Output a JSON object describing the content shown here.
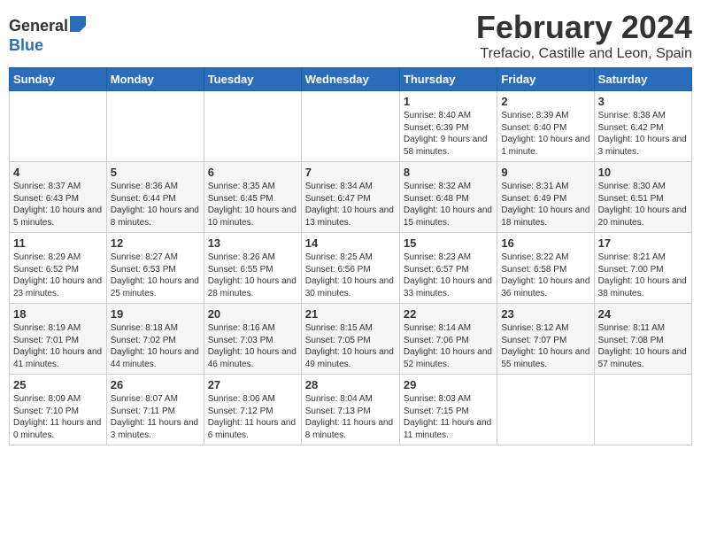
{
  "header": {
    "logo_general": "General",
    "logo_blue": "Blue",
    "title": "February 2024",
    "subtitle": "Trefacio, Castille and Leon, Spain"
  },
  "calendar": {
    "days_of_week": [
      "Sunday",
      "Monday",
      "Tuesday",
      "Wednesday",
      "Thursday",
      "Friday",
      "Saturday"
    ],
    "weeks": [
      [
        {
          "day": "",
          "info": ""
        },
        {
          "day": "",
          "info": ""
        },
        {
          "day": "",
          "info": ""
        },
        {
          "day": "",
          "info": ""
        },
        {
          "day": "1",
          "info": "Sunrise: 8:40 AM\nSunset: 6:39 PM\nDaylight: 9 hours and 58 minutes."
        },
        {
          "day": "2",
          "info": "Sunrise: 8:39 AM\nSunset: 6:40 PM\nDaylight: 10 hours and 1 minute."
        },
        {
          "day": "3",
          "info": "Sunrise: 8:38 AM\nSunset: 6:42 PM\nDaylight: 10 hours and 3 minutes."
        }
      ],
      [
        {
          "day": "4",
          "info": "Sunrise: 8:37 AM\nSunset: 6:43 PM\nDaylight: 10 hours and 5 minutes."
        },
        {
          "day": "5",
          "info": "Sunrise: 8:36 AM\nSunset: 6:44 PM\nDaylight: 10 hours and 8 minutes."
        },
        {
          "day": "6",
          "info": "Sunrise: 8:35 AM\nSunset: 6:45 PM\nDaylight: 10 hours and 10 minutes."
        },
        {
          "day": "7",
          "info": "Sunrise: 8:34 AM\nSunset: 6:47 PM\nDaylight: 10 hours and 13 minutes."
        },
        {
          "day": "8",
          "info": "Sunrise: 8:32 AM\nSunset: 6:48 PM\nDaylight: 10 hours and 15 minutes."
        },
        {
          "day": "9",
          "info": "Sunrise: 8:31 AM\nSunset: 6:49 PM\nDaylight: 10 hours and 18 minutes."
        },
        {
          "day": "10",
          "info": "Sunrise: 8:30 AM\nSunset: 6:51 PM\nDaylight: 10 hours and 20 minutes."
        }
      ],
      [
        {
          "day": "11",
          "info": "Sunrise: 8:29 AM\nSunset: 6:52 PM\nDaylight: 10 hours and 23 minutes."
        },
        {
          "day": "12",
          "info": "Sunrise: 8:27 AM\nSunset: 6:53 PM\nDaylight: 10 hours and 25 minutes."
        },
        {
          "day": "13",
          "info": "Sunrise: 8:26 AM\nSunset: 6:55 PM\nDaylight: 10 hours and 28 minutes."
        },
        {
          "day": "14",
          "info": "Sunrise: 8:25 AM\nSunset: 6:56 PM\nDaylight: 10 hours and 30 minutes."
        },
        {
          "day": "15",
          "info": "Sunrise: 8:23 AM\nSunset: 6:57 PM\nDaylight: 10 hours and 33 minutes."
        },
        {
          "day": "16",
          "info": "Sunrise: 8:22 AM\nSunset: 6:58 PM\nDaylight: 10 hours and 36 minutes."
        },
        {
          "day": "17",
          "info": "Sunrise: 8:21 AM\nSunset: 7:00 PM\nDaylight: 10 hours and 38 minutes."
        }
      ],
      [
        {
          "day": "18",
          "info": "Sunrise: 8:19 AM\nSunset: 7:01 PM\nDaylight: 10 hours and 41 minutes."
        },
        {
          "day": "19",
          "info": "Sunrise: 8:18 AM\nSunset: 7:02 PM\nDaylight: 10 hours and 44 minutes."
        },
        {
          "day": "20",
          "info": "Sunrise: 8:16 AM\nSunset: 7:03 PM\nDaylight: 10 hours and 46 minutes."
        },
        {
          "day": "21",
          "info": "Sunrise: 8:15 AM\nSunset: 7:05 PM\nDaylight: 10 hours and 49 minutes."
        },
        {
          "day": "22",
          "info": "Sunrise: 8:14 AM\nSunset: 7:06 PM\nDaylight: 10 hours and 52 minutes."
        },
        {
          "day": "23",
          "info": "Sunrise: 8:12 AM\nSunset: 7:07 PM\nDaylight: 10 hours and 55 minutes."
        },
        {
          "day": "24",
          "info": "Sunrise: 8:11 AM\nSunset: 7:08 PM\nDaylight: 10 hours and 57 minutes."
        }
      ],
      [
        {
          "day": "25",
          "info": "Sunrise: 8:09 AM\nSunset: 7:10 PM\nDaylight: 11 hours and 0 minutes."
        },
        {
          "day": "26",
          "info": "Sunrise: 8:07 AM\nSunset: 7:11 PM\nDaylight: 11 hours and 3 minutes."
        },
        {
          "day": "27",
          "info": "Sunrise: 8:06 AM\nSunset: 7:12 PM\nDaylight: 11 hours and 6 minutes."
        },
        {
          "day": "28",
          "info": "Sunrise: 8:04 AM\nSunset: 7:13 PM\nDaylight: 11 hours and 8 minutes."
        },
        {
          "day": "29",
          "info": "Sunrise: 8:03 AM\nSunset: 7:15 PM\nDaylight: 11 hours and 11 minutes."
        },
        {
          "day": "",
          "info": ""
        },
        {
          "day": "",
          "info": ""
        }
      ]
    ]
  }
}
